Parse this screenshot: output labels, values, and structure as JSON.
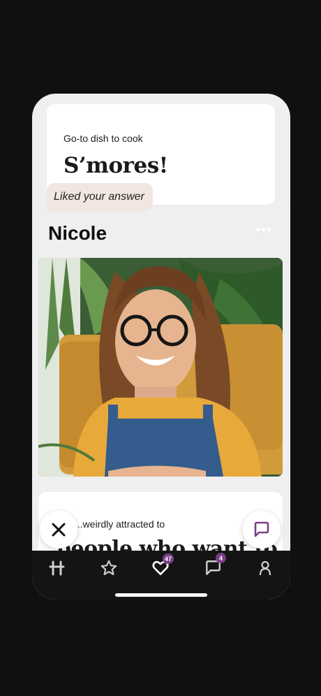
{
  "prompt_card": {
    "question": "Go-to dish to cook",
    "answer": "S’mores!",
    "liked_label": "Liked your answer"
  },
  "profile": {
    "name": "Nicole"
  },
  "second_prompt": {
    "question": "...weirdly attracted to",
    "answer_partial": "people who want to"
  },
  "nav": {
    "items": [
      {
        "name": "home",
        "icon": "hinge-logo-icon"
      },
      {
        "name": "standouts",
        "icon": "star-icon"
      },
      {
        "name": "likes-you",
        "icon": "heart-icon",
        "badge": "47"
      },
      {
        "name": "matches",
        "icon": "chat-icon",
        "badge": "4"
      },
      {
        "name": "profile",
        "icon": "person-icon"
      }
    ]
  },
  "colors": {
    "accent": "#7a3f87",
    "liked_bubble": "#f2e6e1",
    "nav_bg": "#141414"
  }
}
